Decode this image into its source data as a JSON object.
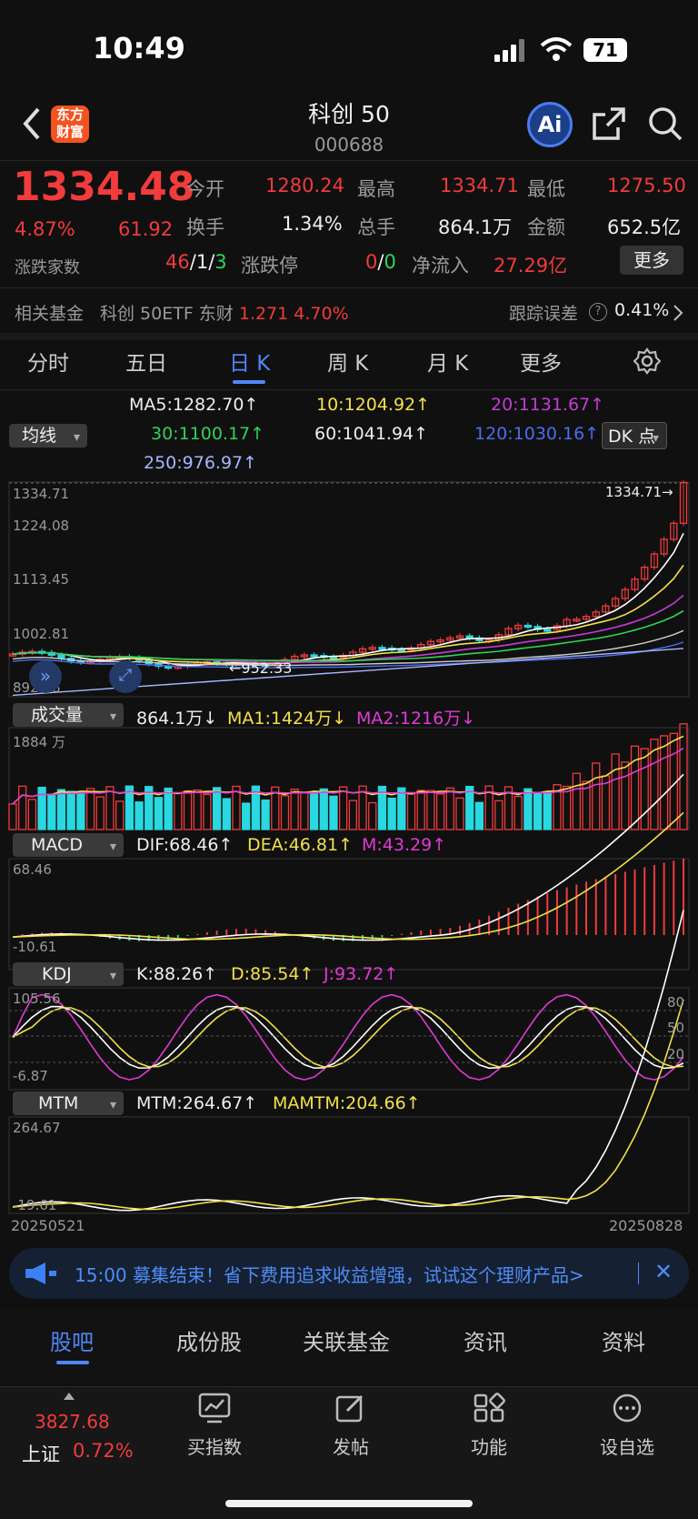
{
  "status": {
    "time": "10:49",
    "battery": "71"
  },
  "header": {
    "logo_line1": "东方",
    "logo_line2": "财富",
    "title": "科创 50",
    "code": "000688",
    "ai_label": "Ai"
  },
  "quote": {
    "price": "1334.48",
    "change_pct": "4.87%",
    "change": "61.92",
    "open_label": "今开",
    "open": "1280.24",
    "high_label": "最高",
    "high": "1334.71",
    "low_label": "最低",
    "low": "1275.50",
    "turnover_label": "换手",
    "turnover": "1.34%",
    "volume_label": "总手",
    "volume": "864.1万",
    "amount_label": "金额",
    "amount": "652.5亿",
    "breadth_label": "涨跌家数",
    "breadth_up": "46",
    "breadth_flat": "1",
    "breadth_down": "3",
    "slash": "/",
    "limit_label": "涨跌停",
    "limit_up": "0",
    "limit_down": "0",
    "inflow_label": "净流入",
    "inflow": "27.29亿",
    "more_label": "更多"
  },
  "fund": {
    "label": "相关基金",
    "name": "科创 50ETF 东财",
    "price": "1.271",
    "pct": "4.70%",
    "track_label": "跟踪误差",
    "track_value": "0.41%"
  },
  "tabs": [
    "分时",
    "五日",
    "日 K",
    "周 K",
    "月 K",
    "更多"
  ],
  "active_tab": 2,
  "ma": {
    "selector": "均线",
    "ma5": "MA5:1282.70",
    "ma10": "10:1204.92",
    "ma20": "20:1131.67",
    "ma30": "30:1100.17",
    "ma60": "60:1041.94",
    "ma120": "120:1030.16",
    "ma250": "250:976.97",
    "dk": "DK 点",
    "up_arrow": "↑",
    "down_arrow": "↓"
  },
  "kline": {
    "y_labels": [
      "1334.71",
      "1224.08",
      "1113.45",
      "1002.81",
      "892.18"
    ],
    "max_label": "1334.71",
    "min_label": "952.33"
  },
  "volume": {
    "selector": "成交量",
    "value": "864.1万",
    "ma1": "MA1:1424万",
    "ma2": "MA2:1216万",
    "y_max": "1884 万"
  },
  "macd": {
    "selector": "MACD",
    "dif": "DIF:68.46",
    "dea": "DEA:46.81",
    "m": "M:43.29",
    "y_max": "68.46",
    "y_min": "-10.61"
  },
  "kdj": {
    "selector": "KDJ",
    "k": "K:88.26",
    "d": "D:85.54",
    "j": "J:93.72",
    "y_max": "105.56",
    "y_min": "-6.87",
    "levels": [
      "80",
      "50",
      "20"
    ]
  },
  "mtm": {
    "selector": "MTM",
    "mtm": "MTM:264.67",
    "mamtm": "MAMTM:204.66",
    "y_max": "264.67",
    "y_min": "-19.61"
  },
  "dates": {
    "start": "20250521",
    "end": "20250828"
  },
  "banner": {
    "text": "15:00 募集结束！省下费用追求收益增强，试试这个理财产品>"
  },
  "subtabs": [
    "股吧",
    "成份股",
    "关联基金",
    "资讯",
    "资料"
  ],
  "active_subtab": 0,
  "bottom": {
    "index_value": "3827.68",
    "index_name": "上证",
    "index_pct": "0.72%",
    "items": [
      "买指数",
      "发帖",
      "功能",
      "设自选"
    ]
  }
}
